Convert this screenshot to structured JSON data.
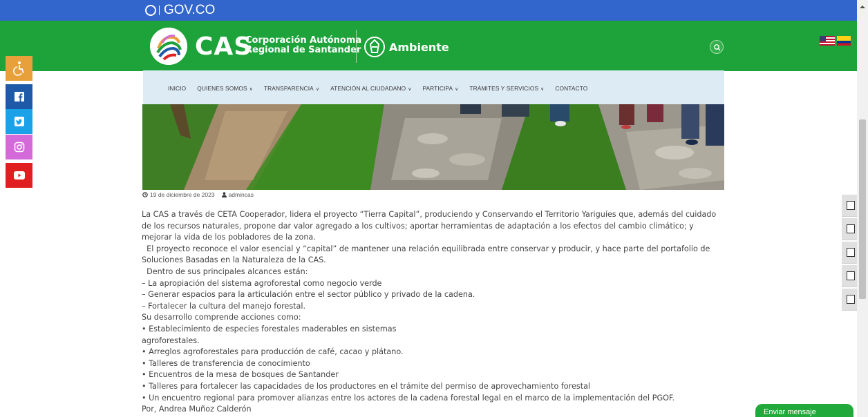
{
  "gov_bar": {
    "label": "GOV.CO"
  },
  "header": {
    "brand": "CAS",
    "brand_sub_1": "Corporación Autónoma",
    "brand_sub_2": "Regional de Santander",
    "ministry": "Ambiente"
  },
  "nav": {
    "items": [
      {
        "label": "INICIO",
        "dropdown": false
      },
      {
        "label": "QUIENES SOMOS",
        "dropdown": true
      },
      {
        "label": "TRANSPARENCIA",
        "dropdown": true
      },
      {
        "label": "ATENCIÓN AL CIUDADANO",
        "dropdown": true
      },
      {
        "label": "PARTICIPA",
        "dropdown": true
      },
      {
        "label": "TRÁMITES Y SERVICIOS",
        "dropdown": true
      },
      {
        "label": "CONTACTO",
        "dropdown": false
      }
    ]
  },
  "post": {
    "date": "19 de diciembre de 2023",
    "author": "admincas"
  },
  "article": {
    "paragraphs": [
      "La CAS a través de CETA Cooperador, lidera el proyecto “Tierra Capital”, produciendo y Conservando el Territorio Yariguíes que, además del cuidado de los recursos naturales, propone dar valor agregado a los cultivos; aportar herramientas de adaptación a los efectos del cambio climático; y mejorar la vida de los pobladores de la zona.",
      "  El proyecto reconoce el valor esencial y “capital” de mantener una relación equilibrada entre conservar y producir, y hace parte del portafolio de Soluciones Basadas en la Naturaleza de la CAS.",
      "  Dentro de sus principales alcances están:",
      "– La apropiación del sistema agroforestal como negocio verde",
      "– Generar espacios para la articulación entre el sector público y privado de la cadena.",
      "– Fortalecer la cultura del manejo forestal.",
      "Su desarrollo comprende acciones como:",
      "• Establecimiento de especies forestales maderables en sistemas",
      "agroforestales.",
      "• Arreglos agroforestales para producción de café, cacao y plátano.",
      "• Talleres de transferencia de conocimiento",
      "• Encuentros de la mesa de bosques de Santander",
      "• Talleres para fortalecer las capacidades de los productores en el trámite del permiso de aprovechamiento forestal",
      "• Un encuentro regional para promover alianzas entre los actores de la cadena forestal legal en el marco de la implementación del PGOF.",
      "Por, Andrea Muñoz Calderón"
    ]
  },
  "social": [
    "accessibility-icon",
    "facebook-icon",
    "twitter-icon",
    "instagram-icon",
    "youtube-icon"
  ],
  "chat": {
    "label": "Enviar mensaje"
  },
  "colors": {
    "gov_blue": "#3366cc",
    "header_green": "#1ea33a",
    "nav_bg": "#ddebf4",
    "chat_green": "#22a93b"
  }
}
